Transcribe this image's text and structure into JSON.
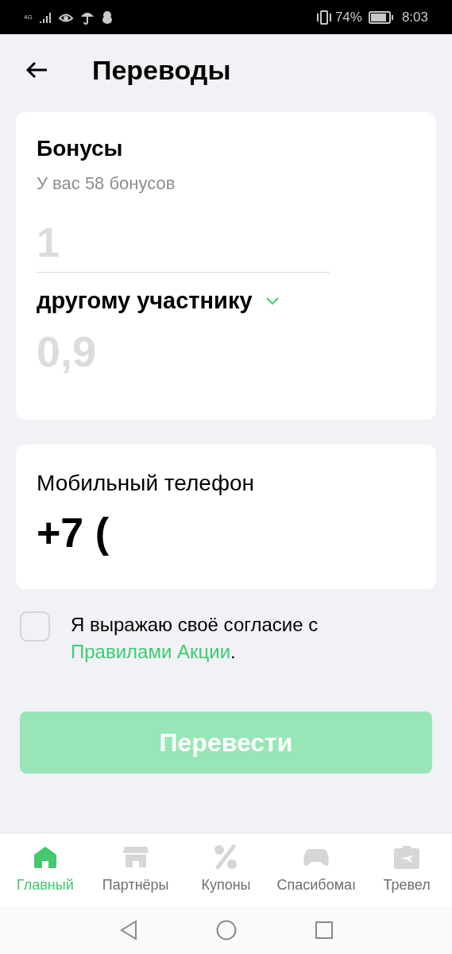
{
  "status_bar": {
    "network": "4G",
    "battery": "74%",
    "time": "8:03"
  },
  "header": {
    "title": "Переводы"
  },
  "bonus_card": {
    "title": "Бонусы",
    "balance": "У вас 58 бонусов",
    "amount": {
      "placeholder": "1"
    },
    "recipient": "другому участнику",
    "result": "0,9"
  },
  "phone_card": {
    "label": "Мобильный телефон",
    "value": "+7 ("
  },
  "consent": {
    "checked": false,
    "text": "Я выражаю своё согласие с",
    "link": "Правилами Акции",
    "end": "."
  },
  "submit": {
    "label": "Перевести",
    "disabled": true
  },
  "bottom_nav": [
    {
      "kind": "home",
      "label": "Главный",
      "selected": true
    },
    {
      "kind": "shop",
      "label": "Партнёры",
      "selected": false
    },
    {
      "kind": "percent",
      "label": "Купоны",
      "selected": false
    },
    {
      "kind": "game",
      "label": "Спасибомаı",
      "selected": false
    },
    {
      "kind": "travel",
      "label": "Тревел",
      "selected": false
    }
  ]
}
